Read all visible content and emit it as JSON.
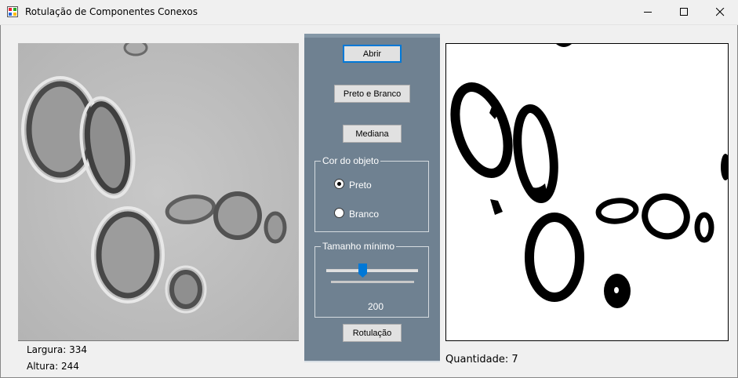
{
  "window": {
    "title": "Rotulação de Componentes Conexos",
    "controls": {
      "minimize_icon": "minimize-icon",
      "maximize_icon": "maximize-icon",
      "close_icon": "close-icon"
    }
  },
  "left_image": {
    "width_label": "Largura: 334",
    "height_label": "Altura: 244"
  },
  "panel": {
    "open_button": "Abrir",
    "bw_button": "Preto e Branco",
    "median_button": "Mediana",
    "object_color": {
      "legend": "Cor do objeto",
      "options": [
        "Preto",
        "Branco"
      ],
      "selected": "Preto"
    },
    "min_size": {
      "legend": "Tamanho mínimo",
      "value": "200"
    },
    "label_button": "Rotulação"
  },
  "right_image": {
    "count_label": "Quantidade: 7"
  },
  "colors": {
    "panel_bg": "#6f8191",
    "accent": "#0078d7"
  }
}
